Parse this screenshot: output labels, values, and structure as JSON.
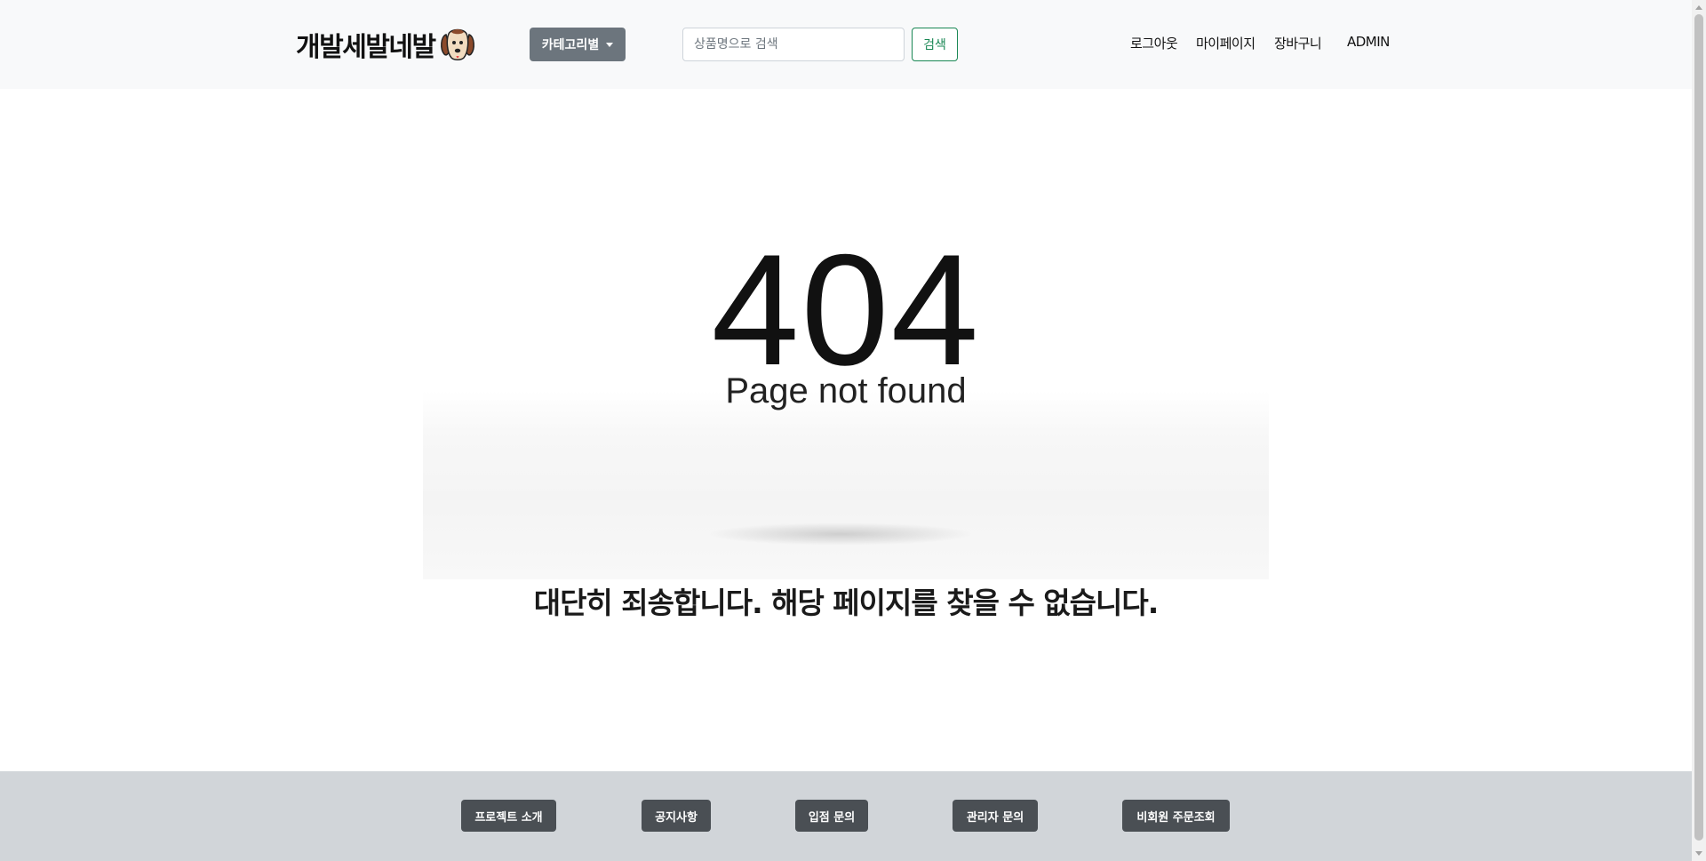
{
  "header": {
    "brand_text": "개발세발네발",
    "brand_logo_icon": "dog-icon",
    "category_button": "카테고리별",
    "search": {
      "placeholder": "상품명으로 검색",
      "value": "",
      "button_label": "검색"
    },
    "nav_links": {
      "logout": "로그아웃",
      "mypage": "마이페이지",
      "cart": "장바구니",
      "admin": "ADMIN"
    }
  },
  "error": {
    "code": "404",
    "caption": "Page not found",
    "message": "대단히 죄송합니다. 해당 페이지를 찾을 수 없습니다."
  },
  "footer": {
    "buttons": {
      "project_intro": "프로젝트 소개",
      "notice": "공지사항",
      "store_inquiry": "입점 문의",
      "admin_inquiry": "관리자 문의",
      "guest_order": "비회원 주문조회"
    }
  },
  "colors": {
    "navbar_bg": "#f8f9fa",
    "category_button_bg": "#6c757d",
    "search_button_border": "#198754",
    "footer_bg": "#d1d5d9",
    "footer_button_bg": "#4a4f54"
  }
}
